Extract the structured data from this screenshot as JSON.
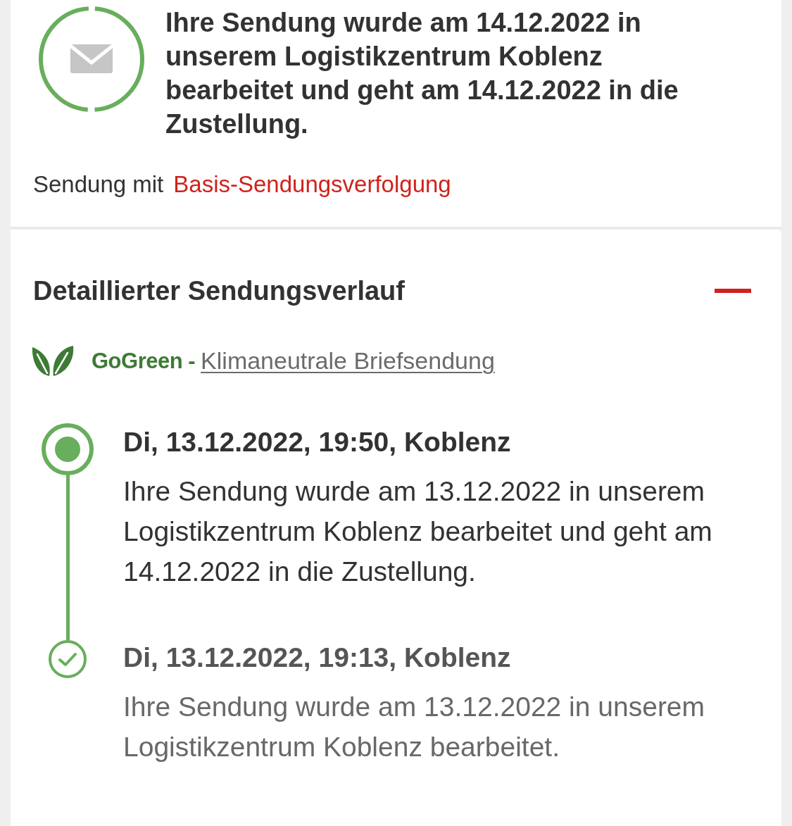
{
  "status": {
    "message": "Ihre Sendung wurde am 14.12.2022 in unserem Logistikzentrum Koblenz bearbeitet und geht am 14.12.2022 in die Zustellung.",
    "service_label": "Sendung mit",
    "service_link": "Basis-Sendungsverfolgung"
  },
  "history": {
    "title": "Detaillierter Sendungsverlauf",
    "expanded": true,
    "gogreen": {
      "brand": "GoGreen -",
      "link": "Klimaneutrale Briefsendung"
    },
    "events": [
      {
        "kind": "current",
        "heading": "Di, 13.12.2022, 19:50, Koblenz",
        "text": "Ihre Sendung wurde am 13.12.2022 in unserem Logistikzentrum Koblenz bearbeitet und geht am 14.12.2022 in die Zustellung."
      },
      {
        "kind": "done",
        "heading": "Di, 13.12.2022, 19:13, Koblenz",
        "text": "Ihre Sendung wurde am 13.12.2022 in unserem Logistikzentrum Koblenz bearbeitet."
      }
    ]
  }
}
